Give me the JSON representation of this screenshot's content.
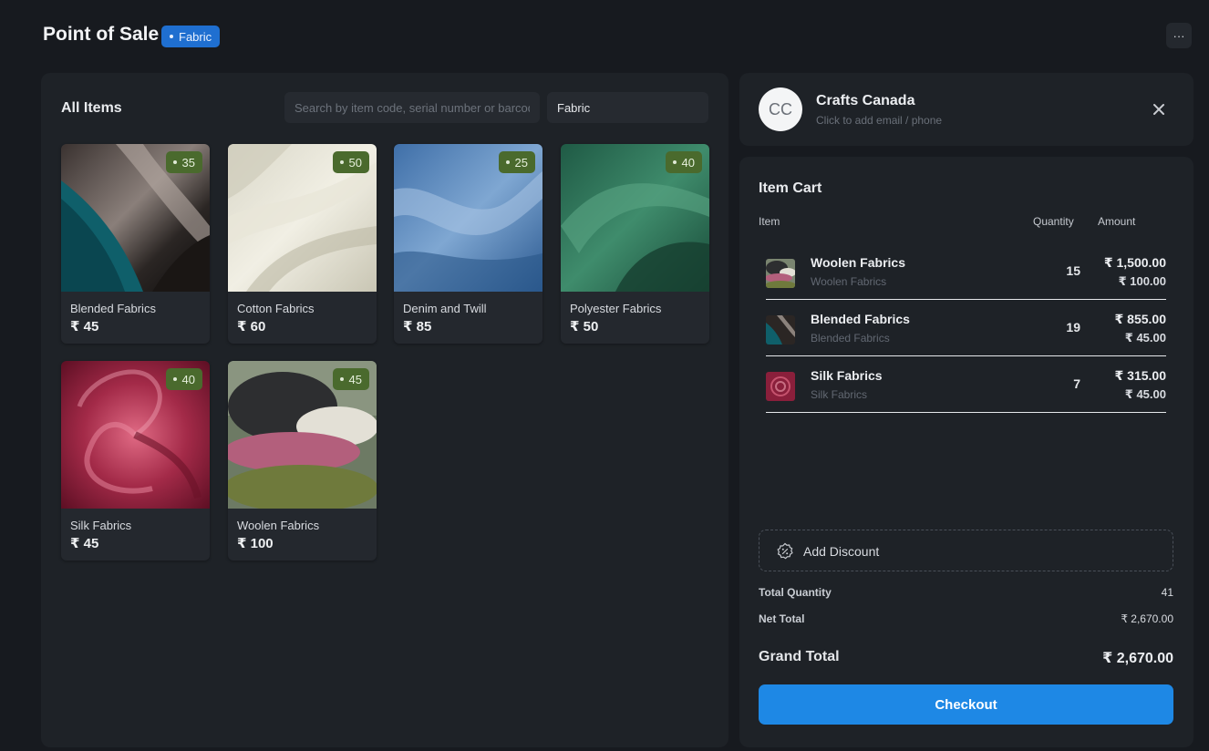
{
  "header": {
    "title": "Point of Sale",
    "profile_badge": "Fabric",
    "more_label": "···"
  },
  "items_panel": {
    "title": "All Items",
    "search_placeholder": "Search by item code, serial number or barcode",
    "item_group": "Fabric",
    "items": [
      {
        "name": "Blended Fabrics",
        "price": "₹ 45",
        "stock": "35"
      },
      {
        "name": "Cotton Fabrics",
        "price": "₹ 60",
        "stock": "50"
      },
      {
        "name": "Denim and Twill",
        "price": "₹ 85",
        "stock": "25"
      },
      {
        "name": "Polyester Fabrics",
        "price": "₹ 50",
        "stock": "40"
      },
      {
        "name": "Silk Fabrics",
        "price": "₹ 45",
        "stock": "40"
      },
      {
        "name": "Woolen Fabrics",
        "price": "₹ 100",
        "stock": "45"
      }
    ]
  },
  "customer": {
    "initials": "CC",
    "name": "Crafts Canada",
    "hint": "Click to add email / phone"
  },
  "cart": {
    "title": "Item Cart",
    "columns": {
      "item": "Item",
      "quantity": "Quantity",
      "amount": "Amount"
    },
    "rows": [
      {
        "name": "Woolen Fabrics",
        "sub": "Woolen Fabrics",
        "qty": "15",
        "amount": "₹ 1,500.00",
        "rate": "₹ 100.00"
      },
      {
        "name": "Blended Fabrics",
        "sub": "Blended Fabrics",
        "qty": "19",
        "amount": "₹ 855.00",
        "rate": "₹ 45.00"
      },
      {
        "name": "Silk Fabrics",
        "sub": "Silk Fabrics",
        "qty": "7",
        "amount": "₹ 315.00",
        "rate": "₹ 45.00"
      }
    ],
    "discount_label": "Add Discount",
    "total_qty_label": "Total Quantity",
    "total_qty": "41",
    "net_total_label": "Net Total",
    "net_total": "₹ 2,670.00",
    "grand_total_label": "Grand Total",
    "grand_total": "₹ 2,670.00",
    "checkout_label": "Checkout"
  },
  "colors": {
    "background": "#171a1f",
    "panel": "#1e2227",
    "accent": "#1e88e5",
    "badge_blue": "#1f6fd0",
    "stock_green": "#4a6a2d"
  }
}
